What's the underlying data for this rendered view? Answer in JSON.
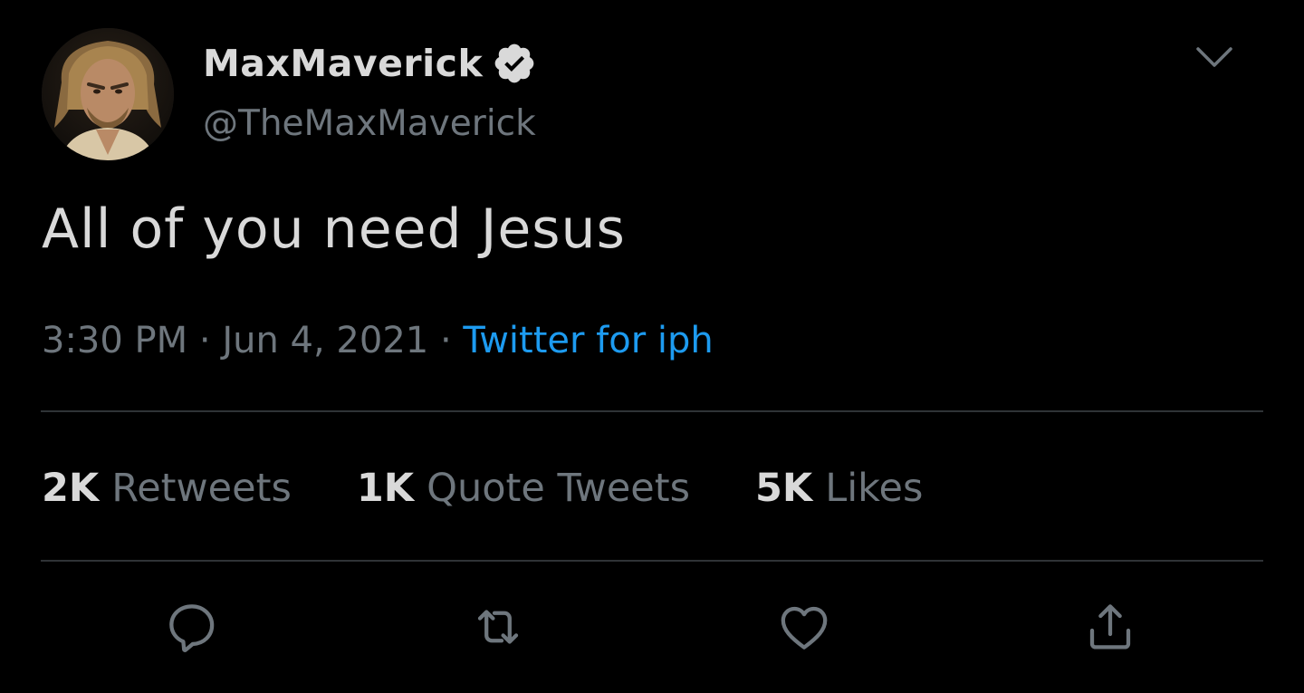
{
  "user": {
    "display_name": "MaxMaverick",
    "handle": "@TheMaxMaverick",
    "verified_icon": "verified-badge-icon",
    "avatar_alt": "profile-photo"
  },
  "tweet": {
    "text": "All of you need Jesus",
    "time": "3:30 PM",
    "separator": "·",
    "date": "Jun 4, 2021",
    "source": "Twitter for iph"
  },
  "stats": [
    {
      "count": "2K",
      "label": "Retweets"
    },
    {
      "count": "1K",
      "label": "Quote Tweets"
    },
    {
      "count": "5K",
      "label": "Likes"
    }
  ],
  "actions": {
    "reply_icon": "reply-icon",
    "retweet_icon": "retweet-icon",
    "like_icon": "heart-icon",
    "share_icon": "share-icon"
  },
  "colors": {
    "background": "#000000",
    "primary_text": "#d9d9d9",
    "secondary_text": "#6e767d",
    "link": "#1d9bf0",
    "divider": "#2f3336"
  }
}
